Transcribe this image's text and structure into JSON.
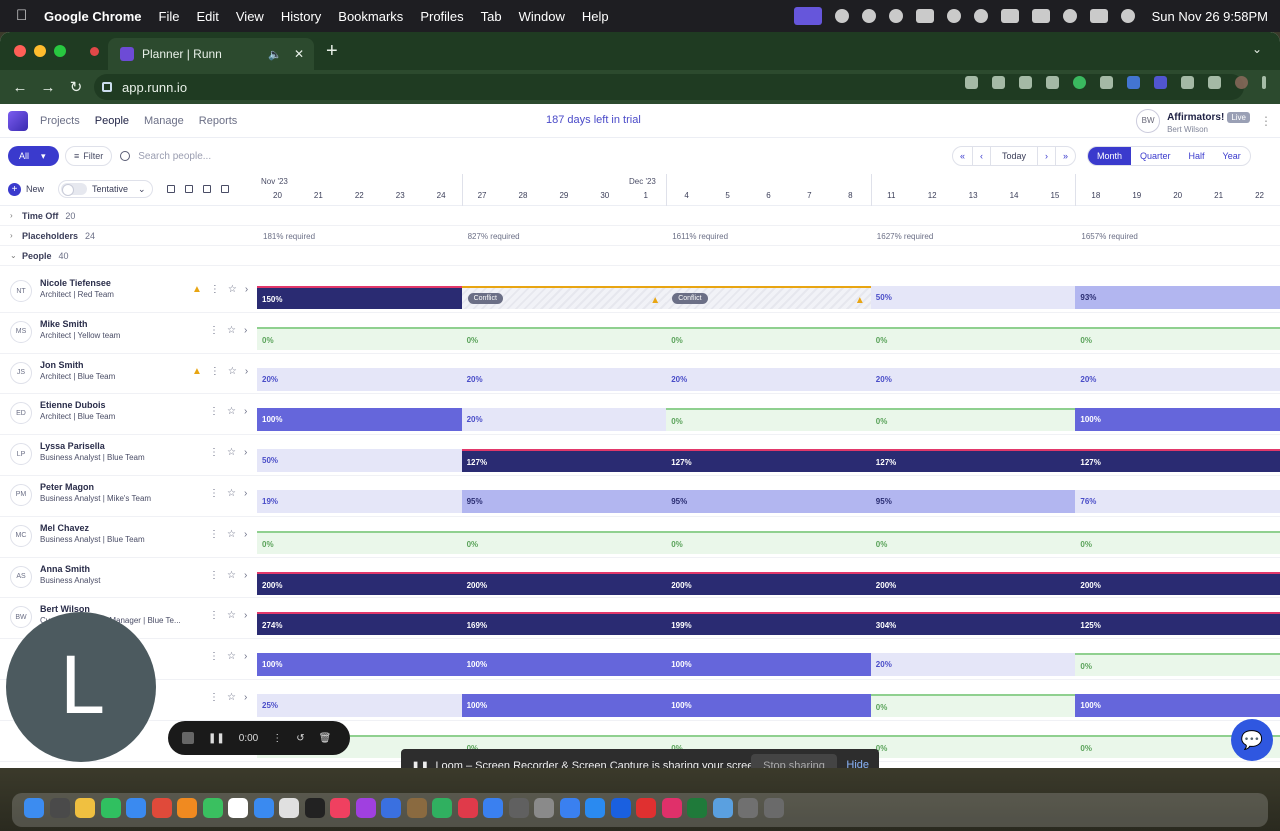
{
  "menubar": {
    "app": "Google Chrome",
    "items": [
      "File",
      "Edit",
      "View",
      "History",
      "Bookmarks",
      "Profiles",
      "Tab",
      "Window",
      "Help"
    ],
    "clock": "Sun Nov 26  9:58PM"
  },
  "browser": {
    "tab_title": "Planner | Runn",
    "url": "app.runn.io"
  },
  "app": {
    "nav": [
      "Projects",
      "People",
      "Manage",
      "Reports"
    ],
    "active_nav": "People",
    "trial_text": "187 days left in trial",
    "org": "Affirmators!",
    "live_badge": "Live",
    "user_name": "Bert Wilson",
    "user_initials": "BW"
  },
  "toolbar": {
    "all_label": "All",
    "filter_label": "Filter",
    "search_placeholder": "Search people...",
    "today": "Today",
    "periods": [
      "Month",
      "Quarter",
      "Half",
      "Year"
    ],
    "active_period": "Month",
    "new_label": "New",
    "tentative_label": "Tentative"
  },
  "timeline": {
    "months": [
      "Nov '23",
      "Dec '23"
    ],
    "days": [
      "20",
      "21",
      "22",
      "23",
      "24",
      "27",
      "28",
      "29",
      "30",
      "1",
      "4",
      "5",
      "6",
      "7",
      "8",
      "11",
      "12",
      "13",
      "14",
      "15",
      "18",
      "19",
      "20",
      "21",
      "22"
    ]
  },
  "sections": {
    "timeoff": {
      "label": "Time Off",
      "count": "20"
    },
    "placeholders": {
      "label": "Placeholders",
      "count": "24",
      "required": [
        "181% required",
        "827% required",
        "1611% required",
        "1627% required",
        "1657% required"
      ]
    },
    "people": {
      "label": "People",
      "count": "40"
    }
  },
  "people": [
    {
      "initials": "NT",
      "name": "Nicole Tiefensee",
      "role": "Architect | Red Team",
      "warn": true,
      "weeks": [
        {
          "v": "150%",
          "l": "over"
        },
        {
          "v": "Conflict",
          "l": "conf"
        },
        {
          "v": "Conflict",
          "l": "conf"
        },
        {
          "v": "50%",
          "l": "low"
        },
        {
          "v": "93%",
          "l": "mid"
        }
      ]
    },
    {
      "initials": "MS",
      "name": "Mike Smith",
      "role": "Architect | Yellow team",
      "warn": false,
      "weeks": [
        {
          "v": "0%",
          "l": "zero"
        },
        {
          "v": "0%",
          "l": "zero"
        },
        {
          "v": "0%",
          "l": "zero"
        },
        {
          "v": "0%",
          "l": "zero"
        },
        {
          "v": "0%",
          "l": "zero"
        }
      ]
    },
    {
      "initials": "JS",
      "name": "Jon Smith",
      "role": "Architect | Blue Team",
      "warn": true,
      "weeks": [
        {
          "v": "20%",
          "l": "low"
        },
        {
          "v": "20%",
          "l": "low"
        },
        {
          "v": "20%",
          "l": "low"
        },
        {
          "v": "20%",
          "l": "low"
        },
        {
          "v": "20%",
          "l": "low"
        }
      ]
    },
    {
      "initials": "ED",
      "name": "Etienne Dubois",
      "role": "Architect | Blue Team",
      "warn": false,
      "weeks": [
        {
          "v": "100%",
          "l": "full"
        },
        {
          "v": "20%",
          "l": "low"
        },
        {
          "v": "0%",
          "l": "zero"
        },
        {
          "v": "0%",
          "l": "zero"
        },
        {
          "v": "100%",
          "l": "full"
        }
      ]
    },
    {
      "initials": "LP",
      "name": "Lyssa Parisella",
      "role": "Business Analyst | Blue Team",
      "warn": false,
      "weeks": [
        {
          "v": "50%",
          "l": "low"
        },
        {
          "v": "127%",
          "l": "over"
        },
        {
          "v": "127%",
          "l": "over"
        },
        {
          "v": "127%",
          "l": "over"
        },
        {
          "v": "127%",
          "l": "over"
        }
      ]
    },
    {
      "initials": "PM",
      "name": "Peter Magon",
      "role": "Business Analyst | Mike's Team",
      "warn": false,
      "weeks": [
        {
          "v": "19%",
          "l": "low"
        },
        {
          "v": "95%",
          "l": "mid"
        },
        {
          "v": "95%",
          "l": "mid"
        },
        {
          "v": "95%",
          "l": "mid"
        },
        {
          "v": "76%",
          "l": "low"
        }
      ]
    },
    {
      "initials": "MC",
      "name": "Mel Chavez",
      "role": "Business Analyst | Blue Team",
      "warn": false,
      "weeks": [
        {
          "v": "0%",
          "l": "zero"
        },
        {
          "v": "0%",
          "l": "zero"
        },
        {
          "v": "0%",
          "l": "zero"
        },
        {
          "v": "0%",
          "l": "zero"
        },
        {
          "v": "0%",
          "l": "zero"
        }
      ]
    },
    {
      "initials": "AS",
      "name": "Anna Smith",
      "role": "Business Analyst",
      "warn": false,
      "weeks": [
        {
          "v": "200%",
          "l": "over"
        },
        {
          "v": "200%",
          "l": "over"
        },
        {
          "v": "200%",
          "l": "over"
        },
        {
          "v": "200%",
          "l": "over"
        },
        {
          "v": "200%",
          "l": "over"
        }
      ]
    },
    {
      "initials": "BW",
      "name": "Bert Wilson",
      "role": "Customer Success Manager | Blue Te...",
      "warn": false,
      "weeks": [
        {
          "v": "274%",
          "l": "over"
        },
        {
          "v": "169%",
          "l": "over"
        },
        {
          "v": "199%",
          "l": "over"
        },
        {
          "v": "304%",
          "l": "over"
        },
        {
          "v": "125%",
          "l": "over"
        }
      ]
    },
    {
      "initials": "",
      "name": "",
      "role": "",
      "warn": false,
      "weeks": [
        {
          "v": "100%",
          "l": "full"
        },
        {
          "v": "100%",
          "l": "full"
        },
        {
          "v": "100%",
          "l": "full"
        },
        {
          "v": "20%",
          "l": "low"
        },
        {
          "v": "0%",
          "l": "zero"
        }
      ]
    },
    {
      "initials": "",
      "name": "",
      "role": "",
      "warn": false,
      "weeks": [
        {
          "v": "25%",
          "l": "low"
        },
        {
          "v": "100%",
          "l": "full"
        },
        {
          "v": "100%",
          "l": "full"
        },
        {
          "v": "0%",
          "l": "zero"
        },
        {
          "v": "100%",
          "l": "full"
        }
      ]
    },
    {
      "initials": "",
      "name": "",
      "role": "",
      "warn": false,
      "weeks": [
        {
          "v": "0%",
          "l": "zero"
        },
        {
          "v": "0%",
          "l": "zero"
        },
        {
          "v": "0%",
          "l": "zero"
        },
        {
          "v": "0%",
          "l": "zero"
        },
        {
          "v": "0%",
          "l": "zero"
        }
      ]
    }
  ],
  "loom": {
    "bubble_letter": "L",
    "timer": "0:00",
    "banner_text": "Loom – Screen Recorder & Screen Capture is sharing your screen.",
    "stop_sharing": "Stop sharing",
    "hide": "Hide"
  }
}
